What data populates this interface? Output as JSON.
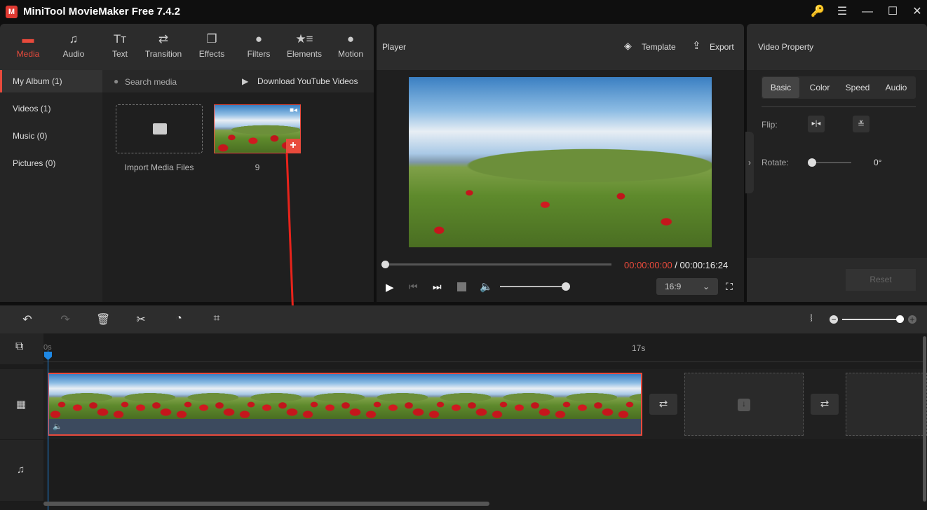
{
  "app": {
    "title": "MiniTool MovieMaker Free 7.4.2",
    "logo_text": "M"
  },
  "window": {
    "key_icon": "key-icon",
    "menu": "☰",
    "minimize": "—",
    "maximize": "☐",
    "close": "✕"
  },
  "toolbar": [
    {
      "label": "Media",
      "icon": "folder-icon",
      "glyph": "▬",
      "active": true
    },
    {
      "label": "Audio",
      "icon": "music-icon",
      "glyph": "♫"
    },
    {
      "label": "Text",
      "icon": "text-icon",
      "glyph": "Tт"
    },
    {
      "label": "Transition",
      "icon": "swap-icon",
      "glyph": "⇄"
    },
    {
      "label": "Effects",
      "icon": "effects-icon",
      "glyph": "❐"
    },
    {
      "label": "Filters",
      "icon": "filters-icon",
      "glyph": "●"
    },
    {
      "label": "Elements",
      "icon": "elements-icon",
      "glyph": "★≡"
    },
    {
      "label": "Motion",
      "icon": "motion-icon",
      "glyph": "●"
    }
  ],
  "sidebar": [
    {
      "label": "My Album (1)",
      "active": true
    },
    {
      "label": "Videos (1)"
    },
    {
      "label": "Music (0)"
    },
    {
      "label": "Pictures (0)"
    }
  ],
  "media": {
    "search_placeholder": "Search media",
    "download": "Download YouTube Videos",
    "import_label": "Import Media Files",
    "clip_name": "9"
  },
  "player": {
    "title": "Player",
    "template": "Template",
    "export": "Export",
    "current_time": "00:00:00:00",
    "separator": " / ",
    "total_time": "00:00:16:24",
    "aspect": "16:9",
    "progress": 0,
    "volume": 1.0
  },
  "property": {
    "title": "Video Property",
    "tabs": [
      "Basic",
      "Color",
      "Speed",
      "Audio"
    ],
    "active_tab": "Basic",
    "flip_label": "Flip:",
    "rotate_label": "Rotate:",
    "rotate_value": "0°",
    "reset": "Reset"
  },
  "timeline": {
    "ruler": [
      "0s",
      "17s"
    ],
    "zoom": 1.0
  },
  "colors": {
    "accent": "#e84a3c",
    "playhead": "#1e88e5"
  }
}
